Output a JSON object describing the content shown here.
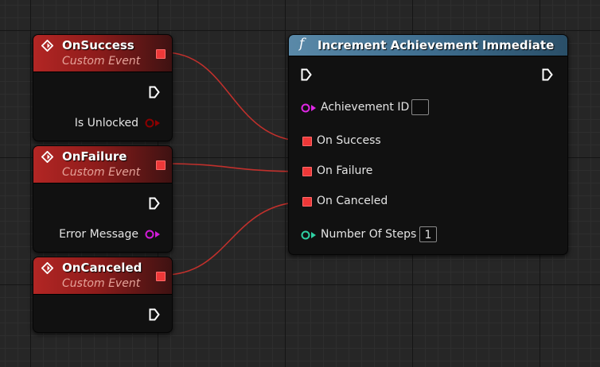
{
  "events": [
    {
      "title": "OnSuccess",
      "subtitle": "Custom Event",
      "output_pin_label": "Is Unlocked",
      "output_pin_type": "boolean",
      "output_pin_color": "#8c0000"
    },
    {
      "title": "OnFailure",
      "subtitle": "Custom Event",
      "output_pin_label": "Error Message",
      "output_pin_type": "string",
      "output_pin_color": "#d21bd8"
    },
    {
      "title": "OnCanceled",
      "subtitle": "Custom Event",
      "output_pin_label": "",
      "output_pin_type": "",
      "output_pin_color": ""
    }
  ],
  "function_node": {
    "icon": "function-icon",
    "icon_glyph": "f",
    "title": "Increment Achievement Immediate",
    "pins": {
      "achievement_id": {
        "label": "Achievement ID",
        "value": "",
        "color": "#e027e6"
      },
      "on_success": {
        "label": "On Success"
      },
      "on_failure": {
        "label": "On Failure"
      },
      "on_canceled": {
        "label": "On Canceled"
      },
      "number_of_steps": {
        "label": "Number Of Steps",
        "value": "1",
        "color": "#2fd1a3"
      }
    }
  },
  "colors": {
    "event_header": "#b32624",
    "function_header": "#5a89a8",
    "delegate_pin": "#ee3838",
    "wire": "#c0302c",
    "exec_pin": "#ffffff",
    "graph_background": "#262626"
  }
}
